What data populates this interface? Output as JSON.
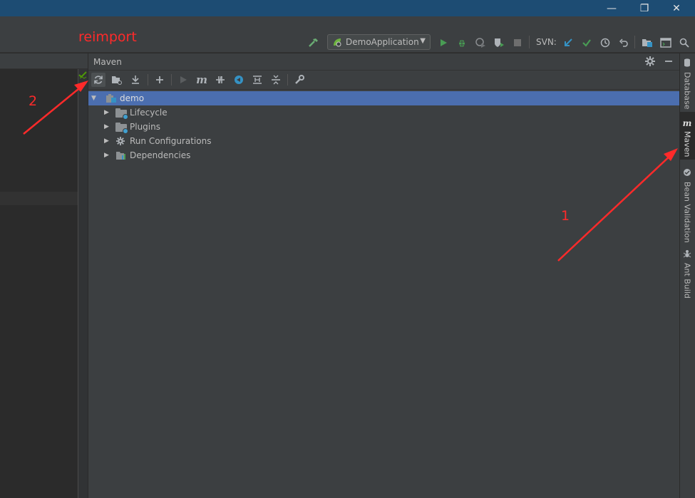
{
  "window": {
    "controls": {
      "minimize": "—",
      "restore": "❐",
      "close": "✕"
    }
  },
  "toolbar": {
    "build_icon": "hammer-icon",
    "run_config": "DemoApplication",
    "run_config_icon": "spring-boot-icon",
    "svn_label": "SVN:",
    "icons": [
      "run-icon",
      "debug-icon",
      "coverage-icon",
      "profile-icon",
      "stop-icon",
      "svn-update-icon",
      "svn-commit-icon",
      "history-icon",
      "revert-icon",
      "project-structure-icon",
      "terminal-icon",
      "search-icon"
    ]
  },
  "maven": {
    "title": "Maven",
    "toolbar_icons": [
      "reimport-icon",
      "generate-sources-icon",
      "download-icon",
      "add-icon",
      "run-goal-icon",
      "execute-maven-goal-icon",
      "toggle-offline-icon",
      "skip-tests-icon",
      "show-dependencies-icon",
      "collapse-all-icon",
      "settings-wrench-icon"
    ],
    "tree": [
      {
        "label": "demo",
        "expanded": true
      },
      {
        "label": "Lifecycle"
      },
      {
        "label": "Plugins"
      },
      {
        "label": "Run Configurations"
      },
      {
        "label": "Dependencies"
      }
    ]
  },
  "sidebar": {
    "tabs": [
      {
        "label": "Database",
        "icon": "database-icon"
      },
      {
        "label": "Maven",
        "icon": "maven-icon",
        "active": true
      },
      {
        "label": "Bean Validation",
        "icon": "bean-validation-icon"
      },
      {
        "label": "Ant Build",
        "icon": "ant-icon"
      }
    ]
  },
  "annotations": {
    "reimport": "reimport",
    "step1": "1",
    "step2": "2"
  },
  "colors": {
    "annotation": "#ff2a2a",
    "selection": "#4b6eaf",
    "titlebar": "#1d4c73",
    "panel": "#3c3f41",
    "run_green": "#499c54"
  }
}
